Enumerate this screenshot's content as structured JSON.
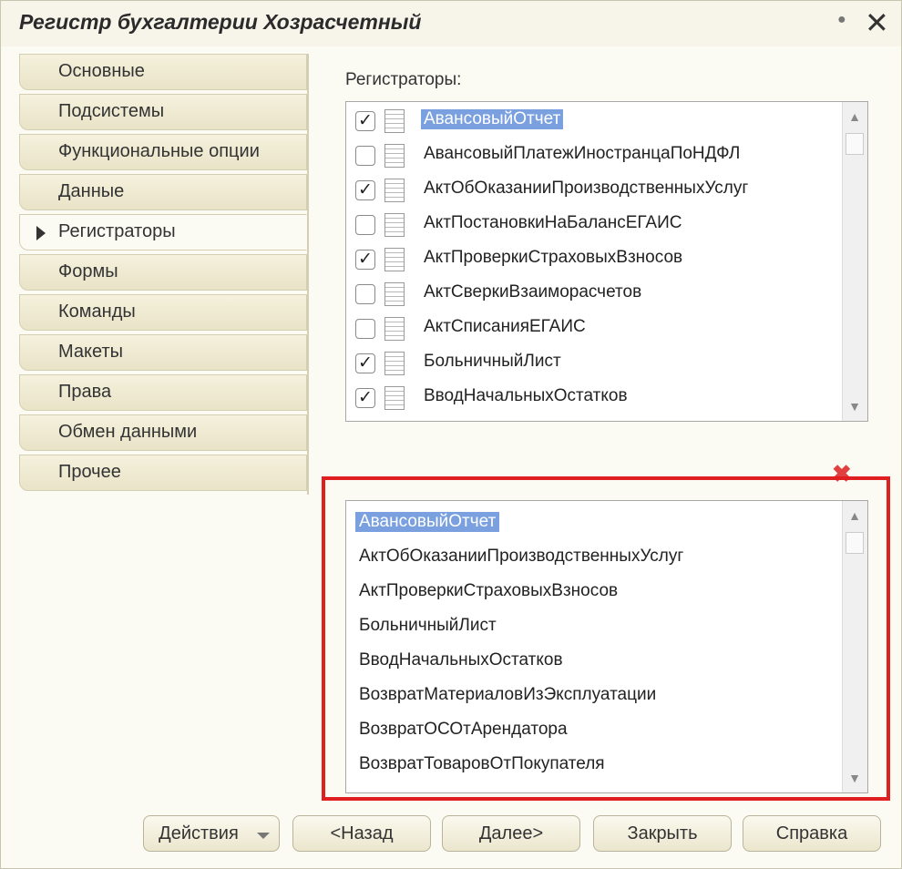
{
  "window": {
    "title": "Регистр бухгалтерии Хозрасчетный"
  },
  "nav": {
    "items": [
      {
        "label": "Основные",
        "active": false
      },
      {
        "label": "Подсистемы",
        "active": false
      },
      {
        "label": "Функциональные опции",
        "active": false
      },
      {
        "label": "Данные",
        "active": false
      },
      {
        "label": "Регистраторы",
        "active": true
      },
      {
        "label": "Формы",
        "active": false
      },
      {
        "label": "Команды",
        "active": false
      },
      {
        "label": "Макеты",
        "active": false
      },
      {
        "label": "Права",
        "active": false
      },
      {
        "label": "Обмен данными",
        "active": false
      },
      {
        "label": "Прочее",
        "active": false
      }
    ]
  },
  "registrators": {
    "label": "Регистраторы:",
    "items": [
      {
        "name": "АвансовыйОтчет",
        "checked": true,
        "selected": true
      },
      {
        "name": "АвансовыйПлатежИностранцаПоНДФЛ",
        "checked": false,
        "selected": false
      },
      {
        "name": "АктОбОказанииПроизводственныхУслуг",
        "checked": true,
        "selected": false
      },
      {
        "name": "АктПостановкиНаБалансЕГАИС",
        "checked": false,
        "selected": false
      },
      {
        "name": "АктПроверкиСтраховыхВзносов",
        "checked": true,
        "selected": false
      },
      {
        "name": "АктСверкиВзаиморасчетов",
        "checked": false,
        "selected": false
      },
      {
        "name": "АктСписанияЕГАИС",
        "checked": false,
        "selected": false
      },
      {
        "name": "БольничныйЛист",
        "checked": true,
        "selected": false
      },
      {
        "name": "ВводНачальныхОстатков",
        "checked": true,
        "selected": false
      }
    ]
  },
  "selected_list": {
    "items": [
      {
        "name": "АвансовыйОтчет",
        "selected": true
      },
      {
        "name": "АктОбОказанииПроизводственныхУслуг",
        "selected": false
      },
      {
        "name": "АктПроверкиСтраховыхВзносов",
        "selected": false
      },
      {
        "name": "БольничныйЛист",
        "selected": false
      },
      {
        "name": "ВводНачальныхОстатков",
        "selected": false
      },
      {
        "name": "ВозвратМатериаловИзЭксплуатации",
        "selected": false
      },
      {
        "name": "ВозвратОСОтАрендатора",
        "selected": false
      },
      {
        "name": "ВозвратТоваровОтПокупателя",
        "selected": false
      }
    ]
  },
  "buttons": {
    "actions": "Действия",
    "back": "<Назад",
    "next": "Далее>",
    "close": "Закрыть",
    "help": "Справка"
  },
  "colors": {
    "selection": "#7aa0e0",
    "highlight": "#e02020",
    "panel": "#e9e3c7"
  }
}
